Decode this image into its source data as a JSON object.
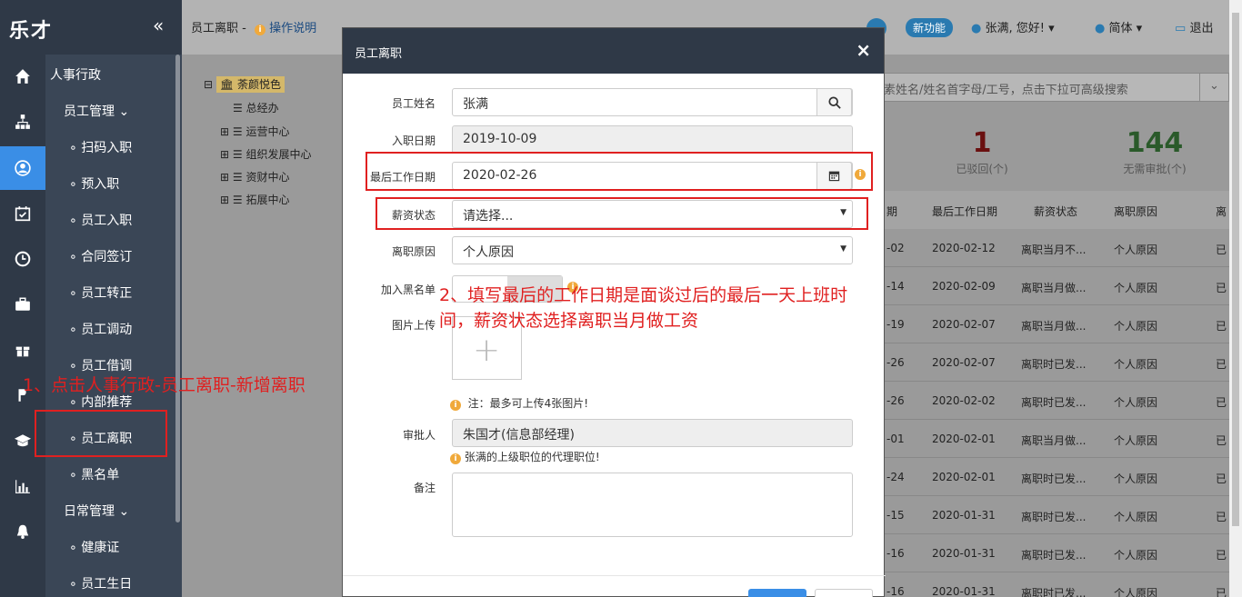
{
  "app": {
    "logo": "乐才",
    "collapse_icon": "«"
  },
  "iconbar": [
    "home-icon",
    "org-icon",
    "user-circle-icon",
    "calendar-check-icon",
    "clock-icon",
    "briefcase-icon",
    "gift-icon",
    "money-icon",
    "graduation-icon",
    "chart-icon",
    "bell-icon"
  ],
  "subnav": {
    "section": "人事行政",
    "group1": "员工管理",
    "items": [
      "扫码入职",
      "预入职",
      "员工入职",
      "合同签订",
      "员工转正",
      "员工调动",
      "员工借调",
      "内部推荐",
      "员工离职",
      "黑名单"
    ],
    "group2": "日常管理",
    "items2": [
      "健康证",
      "员工生日"
    ]
  },
  "topbar": {
    "breadcrumb": "员工离职 -",
    "help": "操作说明",
    "new_feature": "新功能",
    "user": "张满, 您好!",
    "lang": "简体",
    "logout": "退出"
  },
  "tree": {
    "root": "荼颜悦色",
    "nodes": [
      "总经办",
      "运营中心",
      "组织发展中心",
      "资财中心",
      "拓展中心"
    ]
  },
  "search": {
    "placeholder": "素姓名/姓名首字母/工号，点击下拉可高级搜索"
  },
  "stats": [
    {
      "num": "1",
      "label": "已驳回(个)",
      "color": "#8b1a1a"
    },
    {
      "num": "144",
      "label": "无需审批(个)",
      "color": "#2e6b2e"
    }
  ],
  "table": {
    "headers": [
      "期",
      "最后工作日期",
      "薪资状态",
      "离职原因",
      "离"
    ],
    "rows": [
      [
        "-02",
        "2020-02-12",
        "离职当月不...",
        "个人原因",
        "已"
      ],
      [
        "-14",
        "2020-02-09",
        "离职当月做...",
        "个人原因",
        "已"
      ],
      [
        "-19",
        "2020-02-07",
        "离职当月做...",
        "个人原因",
        "已"
      ],
      [
        "-26",
        "2020-02-07",
        "离职时已发...",
        "个人原因",
        "已"
      ],
      [
        "-26",
        "2020-02-02",
        "离职时已发...",
        "个人原因",
        "已"
      ],
      [
        "-01",
        "2020-02-01",
        "离职当月做...",
        "个人原因",
        "已"
      ],
      [
        "-24",
        "2020-02-01",
        "离职时已发...",
        "个人原因",
        "已"
      ],
      [
        "-15",
        "2020-01-31",
        "离职时已发...",
        "个人原因",
        "已"
      ],
      [
        "-16",
        "2020-01-31",
        "离职时已发...",
        "个人原因",
        "已"
      ],
      [
        "-16",
        "2020-01-31",
        "离职时已发...",
        "个人原因",
        "已"
      ]
    ]
  },
  "modal": {
    "title": "员工离职",
    "close": "×",
    "labels": {
      "name": "员工姓名",
      "hire": "入职日期",
      "last_day": "最后工作日期",
      "salary": "薪资状态",
      "reason": "离职原因",
      "blacklist": "加入黑名单",
      "upload": "图片上传",
      "approver": "审批人",
      "remark": "备注"
    },
    "values": {
      "name": "张满",
      "hire": "2019-10-09",
      "last_day": "2020-02-26",
      "salary": "请选择...",
      "reason": "个人原因",
      "approver": "朱国才(信息部经理)"
    },
    "upload_note": "注：最多可上传4张图片!",
    "approver_note": "张满的上级职位的代理职位!"
  },
  "annotations": {
    "step1": "1、点击人事行政-员工离职-新增离职",
    "step2_line1": "2、填写最后的工作日期是面谈过后的最后一天上班时",
    "step2_line2": "间，薪资状态选择离职当月做工资"
  }
}
